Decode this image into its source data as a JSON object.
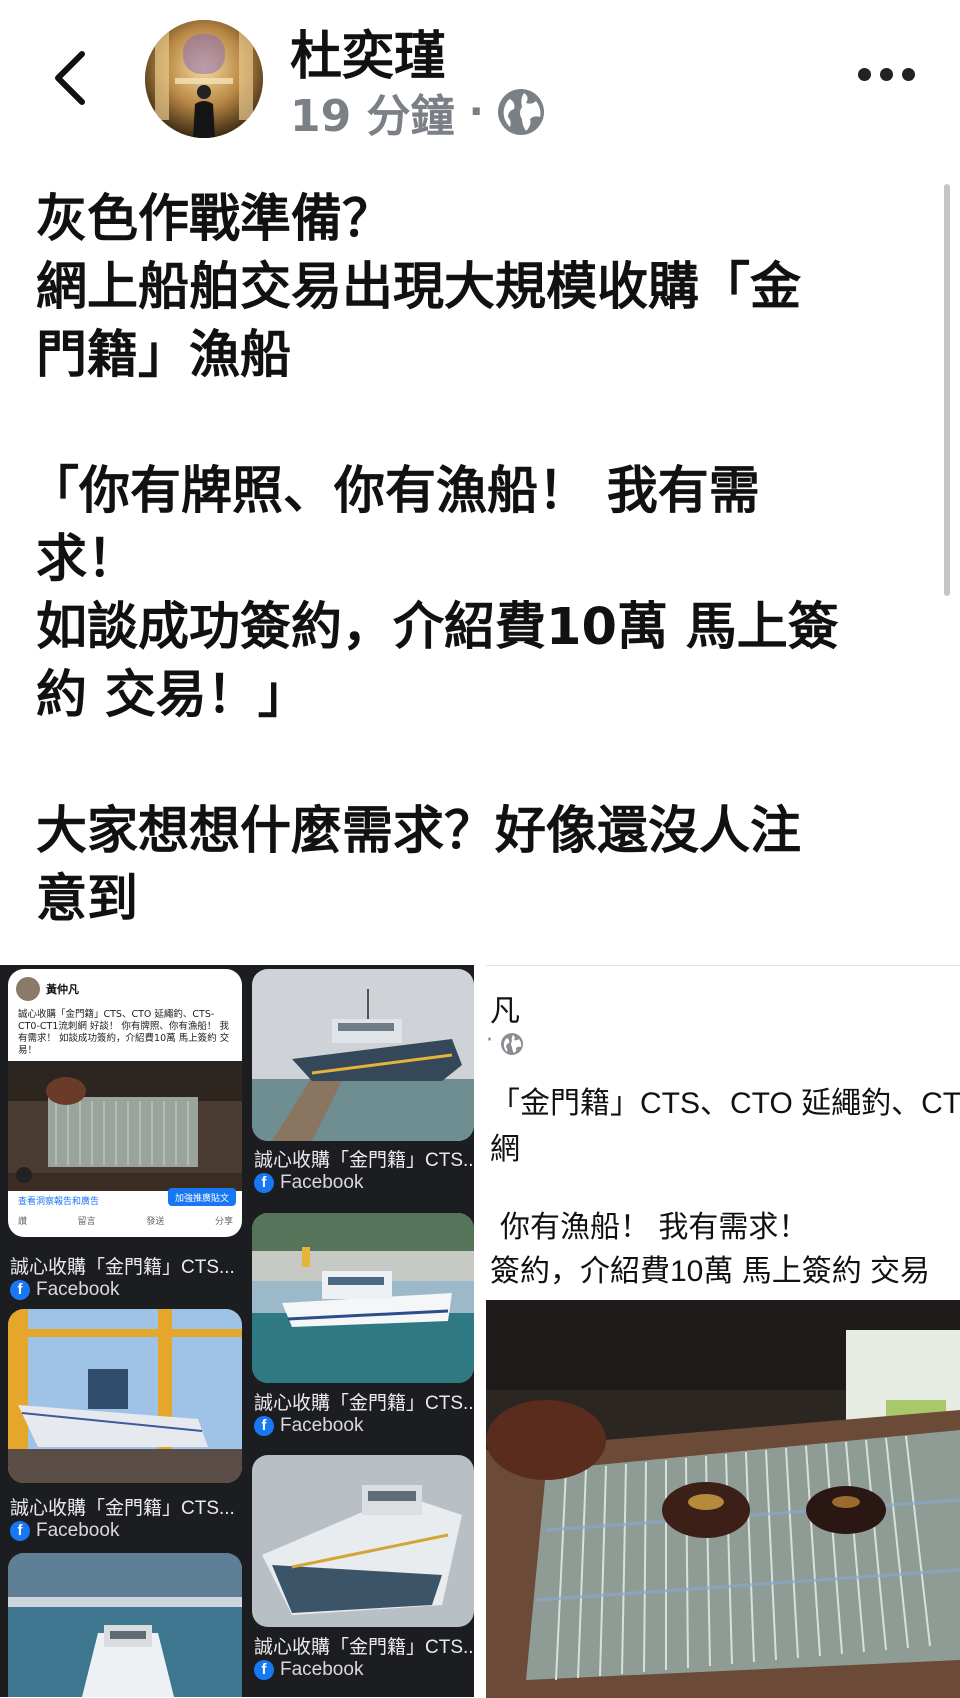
{
  "header": {
    "author": "杜奕瑾",
    "time": "19 分鐘",
    "dot": "·",
    "icons": {
      "back": "chevron-left-icon",
      "privacy": "globe-icon",
      "more": "more-icon"
    }
  },
  "post": {
    "lines": [
      "灰色作戰準備？",
      "網上船舶交易出現大規模收購「金",
      "門籍」漁船",
      "",
      "「你有牌照、你有漁船！  我有需",
      "求！",
      "如談成功簽約，介紹費10萬 馬上簽",
      "約 交易！」",
      "",
      "大家想想什麼需求？好像還沒人注",
      "意到"
    ]
  },
  "media": {
    "left": {
      "results": [
        {
          "caption": "誠心收購「金門籍」CTS...",
          "source": "Facebook"
        },
        {
          "caption": "誠心收購「金門籍」CTS...",
          "source": "Facebook"
        },
        {
          "caption": "誠心收購「金門籍」CTS...",
          "source": "Facebook"
        },
        {
          "caption": "誠心收購「金門籍」CTS...",
          "source": "Facebook"
        },
        {
          "caption": "誠心收購「金門籍」CTS...",
          "source": "Facebook"
        }
      ],
      "mini_post": {
        "name": "黃仲凡",
        "text": "誠心收購「金門籍」CTS、CTO 延繩釣、CTS-CT0-CT1流刺網 好談！ 你有牌照、你有漁船！ 我有需求！ 如談成功簽約，介紹費10萬 馬上簽約 交易！",
        "link": "查看洞察報告和廣告",
        "button": "加強推廣貼文",
        "actions": [
          "讚",
          "留言",
          "發送",
          "分享"
        ]
      }
    },
    "right": {
      "name": "凡",
      "lines": [
        "「金門籍」CTS、CTO 延繩釣、CT",
        "網",
        "你有漁船！  我有需求！",
        "簽約，介紹費10萬 馬上簽約 交易"
      ]
    }
  },
  "colors": {
    "facebook_blue": "#1877f2",
    "meta_gray": "#7b7f86",
    "dark_panel": "#1b1d20"
  }
}
